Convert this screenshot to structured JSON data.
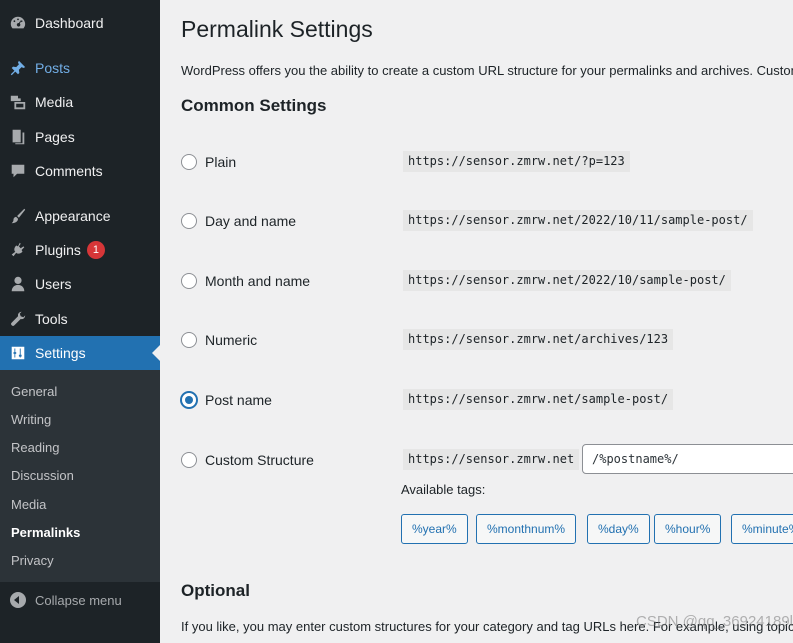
{
  "sidebar": {
    "items": [
      {
        "label": "Dashboard",
        "icon": "dashboard-icon"
      },
      {
        "label": "Posts",
        "icon": "pin-icon"
      },
      {
        "label": "Media",
        "icon": "media-icon"
      },
      {
        "label": "Pages",
        "icon": "pages-icon"
      },
      {
        "label": "Comments",
        "icon": "comment-icon"
      },
      {
        "label": "Appearance",
        "icon": "brush-icon"
      },
      {
        "label": "Plugins",
        "icon": "plugin-icon",
        "badge": "1"
      },
      {
        "label": "Users",
        "icon": "user-icon"
      },
      {
        "label": "Tools",
        "icon": "wrench-icon"
      },
      {
        "label": "Settings",
        "icon": "settings-icon"
      }
    ],
    "submenu": [
      "General",
      "Writing",
      "Reading",
      "Discussion",
      "Media",
      "Permalinks",
      "Privacy"
    ],
    "collapse_label": "Collapse menu"
  },
  "page": {
    "title": "Permalink Settings",
    "intro": "WordPress offers you the ability to create a custom URL structure for your permalinks and archives. Custom",
    "common_heading": "Common Settings",
    "options": [
      {
        "label": "Plain",
        "example": "https://sensor.zmrw.net/?p=123"
      },
      {
        "label": "Day and name",
        "example": "https://sensor.zmrw.net/2022/10/11/sample-post/"
      },
      {
        "label": "Month and name",
        "example": "https://sensor.zmrw.net/2022/10/sample-post/"
      },
      {
        "label": "Numeric",
        "example": "https://sensor.zmrw.net/archives/123"
      },
      {
        "label": "Post name",
        "example": "https://sensor.zmrw.net/sample-post/"
      },
      {
        "label": "Custom Structure",
        "example": "https://sensor.zmrw.net"
      }
    ],
    "selected_option": "Post name",
    "custom_value": "/%postname%/",
    "available_tags_label": "Available tags:",
    "tags": [
      "%year%",
      "%monthnum%",
      "%day%",
      "%hour%",
      "%minute%"
    ],
    "optional_heading": "Optional",
    "optional_text": "If you like, you may enter custom structures for your category and tag URLs here. For example, using topic",
    "watermark": "CSDN @qq_36924189l"
  },
  "colors": {
    "sidebar_bg": "#1d2327",
    "accent": "#2271b1",
    "badge": "#d63638",
    "posts_link": "#72aee6"
  }
}
